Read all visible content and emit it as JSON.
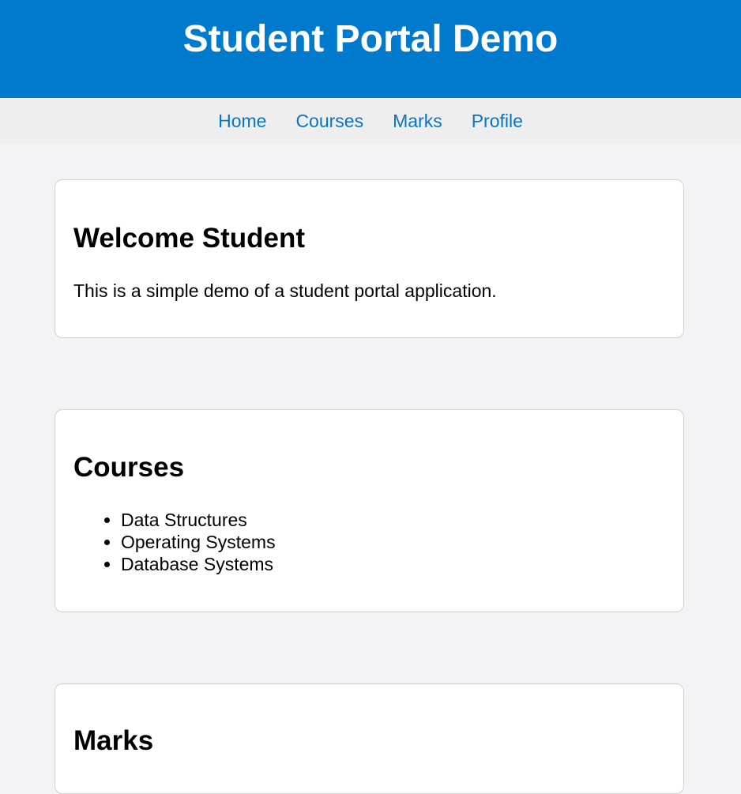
{
  "header": {
    "title": "Student Portal Demo"
  },
  "nav": {
    "items": [
      {
        "label": "Home"
      },
      {
        "label": "Courses"
      },
      {
        "label": "Marks"
      },
      {
        "label": "Profile"
      }
    ]
  },
  "welcome": {
    "title": "Welcome Student",
    "text": "This is a simple demo of a student portal application."
  },
  "courses": {
    "title": "Courses",
    "items": [
      "Data Structures",
      "Operating Systems",
      "Database Systems"
    ]
  },
  "marks": {
    "title": "Marks"
  },
  "colors": {
    "header_bg": "#007acc",
    "nav_bg": "#eeeeee",
    "link": "#0a74c4",
    "page_bg": "#f3f3f6"
  }
}
